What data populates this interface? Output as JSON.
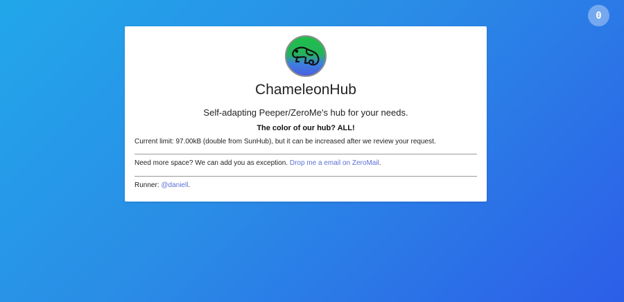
{
  "badge": {
    "count": "0"
  },
  "hub": {
    "logo_icon": "chameleon-icon",
    "name": "ChameleonHub",
    "subtitle": "Self-adapting Peeper/ZeroMe's hub for your needs.",
    "tagline": "The color of our hub? ALL!",
    "limit_text": "Current limit: 97.00kB (double from SunHub), but it can be increased after we review your request.",
    "space_text": "Need more space? We can add you as exception. ",
    "space_link": "Drop me a email on ZeroMail",
    "space_suffix": ".",
    "runner_prefix": "Runner: ",
    "runner_link": "@daniell",
    "runner_suffix": "."
  },
  "colors": {
    "background_start": "#22a7ea",
    "background_end": "#2c5ee8",
    "link": "#5a6fd6",
    "card": "#ffffff"
  }
}
